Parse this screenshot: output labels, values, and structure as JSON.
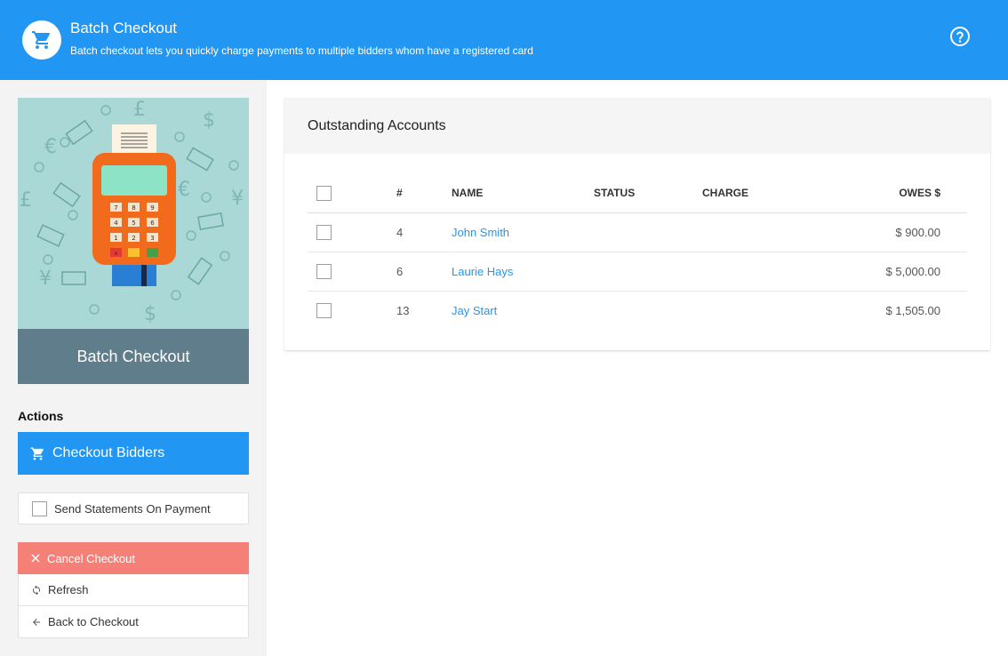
{
  "header": {
    "title": "Batch Checkout",
    "subtitle": "Batch checkout lets you quickly charge payments to multiple bidders whom have a registered card",
    "icon": "cart-icon",
    "help_icon": "help-circle-icon"
  },
  "sidebar": {
    "promo_caption": "Batch Checkout",
    "actions_label": "Actions",
    "checkout_button": "Checkout Bidders",
    "send_statements_label": "Send Statements On Payment",
    "menu": [
      {
        "label": "Cancel Checkout",
        "icon": "close-icon"
      },
      {
        "label": "Refresh",
        "icon": "refresh-icon"
      },
      {
        "label": "Back to Checkout",
        "icon": "arrow-left-icon"
      }
    ]
  },
  "main": {
    "card_title": "Outstanding Accounts",
    "columns": {
      "num": "#",
      "name": "NAME",
      "status": "STATUS",
      "charge": "CHARGE",
      "owes": "OWES $"
    },
    "rows": [
      {
        "num": "4",
        "name": "John Smith",
        "status": "",
        "charge": "",
        "owes": "$ 900.00"
      },
      {
        "num": "6",
        "name": "Laurie Hays",
        "status": "",
        "charge": "",
        "owes": "$ 5,000.00"
      },
      {
        "num": "13",
        "name": "Jay Start",
        "status": "",
        "charge": "",
        "owes": "$ 1,505.00"
      }
    ]
  },
  "colors": {
    "primary": "#2196f3",
    "danger": "#f58078",
    "caption_bg": "#607d8b",
    "promo_bg": "#a9d8d6"
  }
}
